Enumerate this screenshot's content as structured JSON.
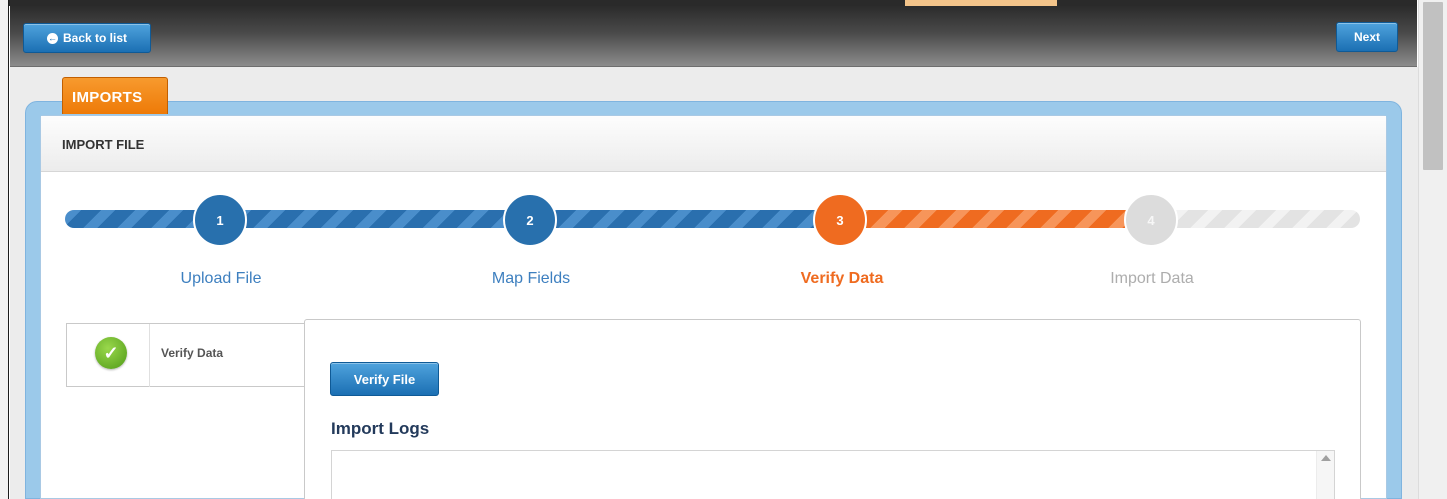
{
  "toolbar": {
    "back_label": "Back to list",
    "next_label": "Next"
  },
  "module_tab": "IMPORTS",
  "panel": {
    "title": "IMPORT FILE"
  },
  "steps": [
    {
      "number": "1",
      "label": "Upload File",
      "state": "complete"
    },
    {
      "number": "2",
      "label": "Map Fields",
      "state": "complete"
    },
    {
      "number": "3",
      "label": "Verify Data",
      "state": "active"
    },
    {
      "number": "4",
      "label": "Import Data",
      "state": "pending"
    }
  ],
  "side_nav": {
    "label": "Verify Data",
    "icon": "check-circle-icon"
  },
  "content": {
    "verify_button": "Verify File",
    "logs_title": "Import Logs",
    "logs_text": ""
  },
  "colors": {
    "accent_blue": "#2870ad",
    "accent_orange": "#ef6b20",
    "pending_gray": "#dcdcdc"
  }
}
